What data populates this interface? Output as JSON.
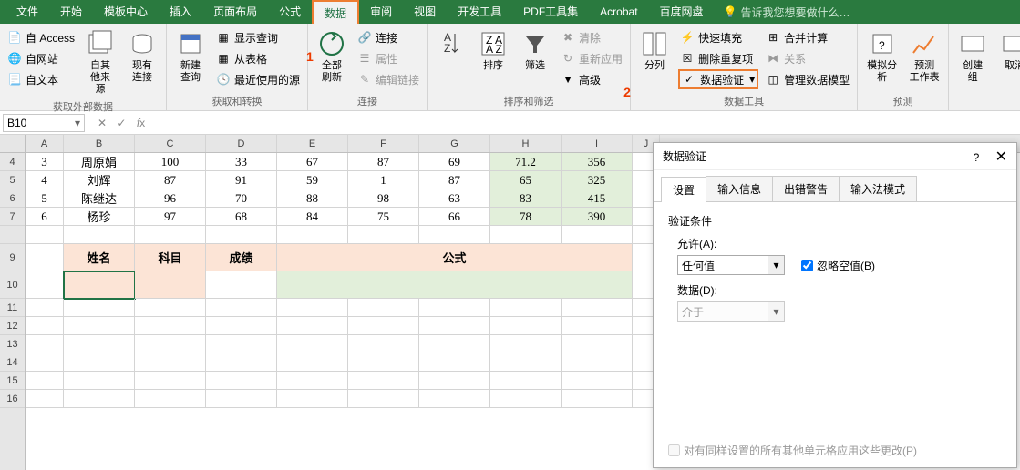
{
  "tabs": [
    "文件",
    "开始",
    "模板中心",
    "插入",
    "页面布局",
    "公式",
    "数据",
    "审阅",
    "视图",
    "开发工具",
    "PDF工具集",
    "Acrobat",
    "百度网盘"
  ],
  "active_tab_index": 6,
  "tell_me": "告诉我您想要做什么…",
  "annotations": {
    "step1": "1",
    "step2": "2"
  },
  "ribbon": {
    "g1": {
      "items": [
        "自 Access",
        "自网站",
        "自文本"
      ],
      "other": "自其他来源",
      "existing": "现有连接",
      "label": "获取外部数据"
    },
    "g2": {
      "new": "新建\n查询",
      "items": [
        "显示查询",
        "从表格",
        "最近使用的源"
      ],
      "label": "获取和转换"
    },
    "g3": {
      "refresh": "全部刷新",
      "items": [
        "连接",
        "属性",
        "编辑链接"
      ],
      "label": "连接"
    },
    "g4": {
      "sort": "排序",
      "filter": "筛选",
      "items": [
        "清除",
        "重新应用",
        "高级"
      ],
      "label": "排序和筛选"
    },
    "g5": {
      "split": "分列",
      "items": [
        "快速填充",
        "删除重复项",
        "数据验证"
      ],
      "items2": [
        "合并计算",
        "关系",
        "管理数据模型"
      ],
      "label": "数据工具"
    },
    "g6": {
      "a": "模拟分析",
      "b": "预测\n工作表",
      "label": "预测"
    },
    "g7": {
      "a": "创建组",
      "b": "取消"
    }
  },
  "cellref": "B10",
  "cols": [
    "A",
    "B",
    "C",
    "D",
    "E",
    "F",
    "G",
    "H",
    "I",
    "J"
  ],
  "row_nums": [
    4,
    5,
    6,
    7,
    "",
    9,
    10,
    11,
    12,
    13,
    14,
    15,
    16
  ],
  "visible_rowhdrs": [
    "4",
    "5",
    "6",
    "7",
    "",
    "9",
    "10",
    "11",
    "12",
    "13",
    "14",
    "15",
    "16"
  ],
  "data_rows": [
    {
      "n": "3",
      "a": "3",
      "b": "周原娟",
      "c": "100",
      "d": "33",
      "e": "67",
      "f": "87",
      "g": "69",
      "h": "71.2",
      "i": "356"
    },
    {
      "n": "5",
      "a": "4",
      "b": "刘辉",
      "c": "87",
      "d": "91",
      "e": "59",
      "f": "1",
      "g": "87",
      "h": "65",
      "i": "325"
    },
    {
      "n": "6",
      "a": "5",
      "b": "陈继达",
      "c": "96",
      "d": "70",
      "e": "88",
      "f": "98",
      "g": "63",
      "h": "83",
      "i": "415"
    },
    {
      "n": "7",
      "a": "6",
      "b": "杨珍",
      "c": "97",
      "d": "68",
      "e": "84",
      "f": "75",
      "g": "66",
      "h": "78",
      "i": "390"
    }
  ],
  "hdr_row": {
    "b": "姓名",
    "c": "科目",
    "d": "成绩",
    "eg": "公式"
  },
  "rowhdr_seq": [
    "4",
    "5",
    "6",
    "7",
    "",
    "9",
    "10",
    "11",
    "12",
    "13",
    "14",
    "15",
    "16"
  ],
  "dialog": {
    "title": "数据验证",
    "tabs": [
      "设置",
      "输入信息",
      "出错警告",
      "输入法模式"
    ],
    "section": "验证条件",
    "allow_lbl": "允许(A):",
    "allow_val": "任何值",
    "ignore": "忽略空值(B)",
    "data_lbl": "数据(D):",
    "data_val": "介于",
    "apply": "对有同样设置的所有其他单元格应用这些更改(P)"
  }
}
